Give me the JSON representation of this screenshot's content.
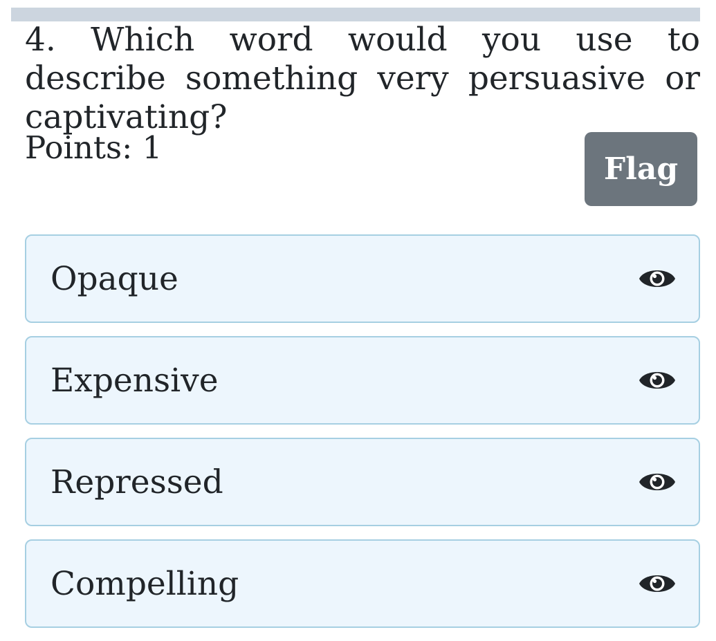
{
  "question": {
    "text": "4. Which word would you use to describe something very persuasive or captivating?"
  },
  "points": {
    "label": "Points: 1"
  },
  "flag_button": {
    "label": "Flag"
  },
  "options": [
    {
      "label": "Opaque",
      "icon": "eye-icon"
    },
    {
      "label": "Expensive",
      "icon": "eye-icon"
    },
    {
      "label": "Repressed",
      "icon": "eye-icon"
    },
    {
      "label": "Compelling",
      "icon": "eye-icon"
    }
  ],
  "colors": {
    "top_bar": "#ccd5df",
    "flag_button_bg": "#6c757d",
    "option_bg": "#edf6fd",
    "option_border": "#a6cfe2",
    "text": "#212529"
  }
}
